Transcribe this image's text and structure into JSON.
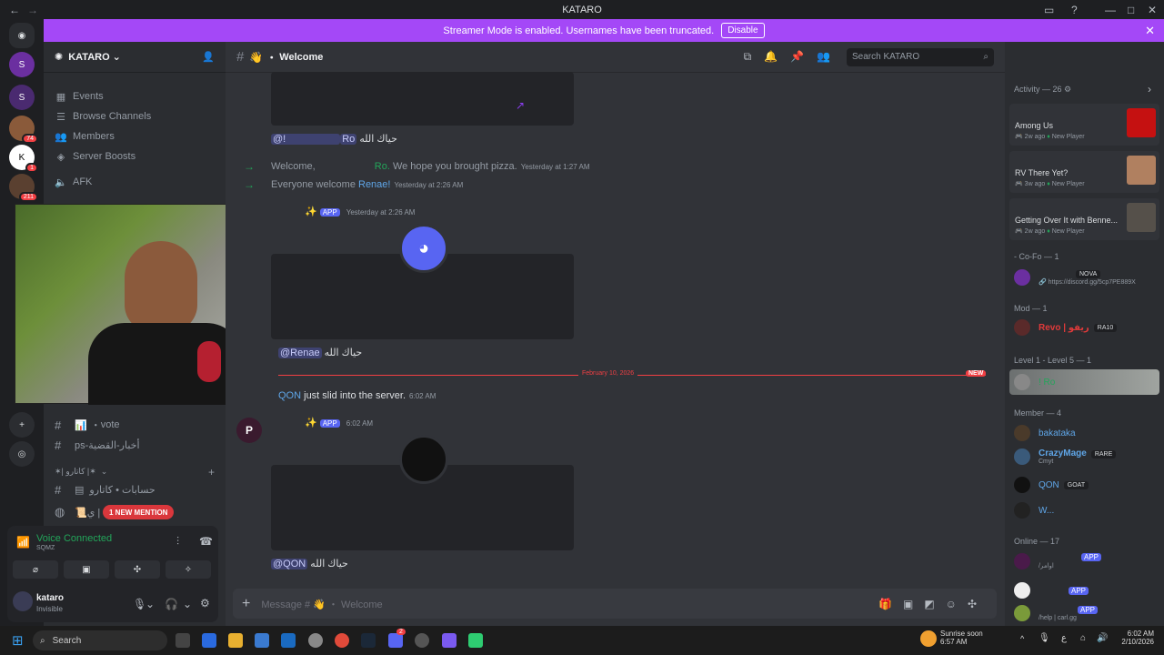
{
  "window": {
    "title": "KATARO"
  },
  "banner": {
    "text": "Streamer Mode is enabled. Usernames have been truncated.",
    "disable_label": "Disable"
  },
  "rail": {
    "badges": [
      "74",
      "1",
      "211"
    ]
  },
  "sidebar": {
    "server_name": "KATARO",
    "nav": [
      {
        "label": "Events",
        "icon": "calendar-icon"
      },
      {
        "label": "Browse Channels",
        "icon": "browse-icon"
      },
      {
        "label": "Members",
        "icon": "members-icon"
      },
      {
        "label": "Server Boosts",
        "icon": "boost-icon"
      }
    ],
    "afk_label": "AFK",
    "channels": [
      {
        "name": "vote"
      },
      {
        "name": "ps-أخبار-القضية"
      }
    ],
    "category": "✶| كاتارو |✶",
    "channel_accounts": "حسابات • كاتارو",
    "mention_pill": "1 NEW MENTION",
    "partial_channel": "ي |"
  },
  "voice": {
    "status": "Voice Connected",
    "sub": "SQMZ"
  },
  "user": {
    "name": "kataro",
    "status": "Invisible"
  },
  "header": {
    "channel": "Welcome",
    "search_placeholder": "Search KATARO"
  },
  "messages": {
    "m1_mention": "@!",
    "m1_name": "Ro",
    "m1_text": "حياك الله",
    "j1_pre": "Welcome,",
    "j1_name": "Ro.",
    "j1_text": "We hope you brought pizza.",
    "j1_time": "Yesterday at 1:27 AM",
    "j2_pre": "Everyone welcome",
    "j2_name": "Renae!",
    "j2_time": "Yesterday at 2:26 AM",
    "b1_time": "Yesterday at 2:26 AM",
    "b1_mention": "@Renae",
    "b1_text": "حياك الله",
    "date_divider": "February 10, 2026",
    "new_label": "NEW",
    "j3_name": "QON",
    "j3_text": "just slid into the server.",
    "j3_time": "6:02 AM",
    "b2_time": "6:02 AM",
    "b2_mention": "@QON",
    "b2_text": "حياك الله",
    "app_label": "APP"
  },
  "composer": {
    "placeholder": "Message # 👋 ・ Welcome"
  },
  "right": {
    "activity_header": "Activity — 26",
    "activities": [
      {
        "game": "Among Us",
        "ago": "2w ago",
        "tag": "New Player"
      },
      {
        "game": "RV There Yet?",
        "ago": "3w ago",
        "tag": "New Player"
      },
      {
        "game": "Getting Over It with Benne...",
        "ago": "2w ago",
        "tag": "New Player"
      }
    ],
    "cofo_header": "- Co-Fo — 1",
    "cofo_tag": "NOVA",
    "cofo_link": "https://discord.gg/5cp7PE889X",
    "mod_header": "Mod — 1",
    "mod_name": "Revo | ريفو",
    "mod_tag": "RA10",
    "level_header": "Level 1 - Level 5 — 1",
    "level_member": "! Ro",
    "member_header": "Member — 4",
    "members": [
      {
        "name": "bakataka"
      },
      {
        "name": "CrazyMage",
        "tag": "RARE",
        "sub": "Cmyt"
      },
      {
        "name": "QON",
        "tag": "GOAT"
      },
      {
        "name": "W..."
      }
    ],
    "online_header": "Online — 17",
    "online": [
      {
        "sub": "/اوامر",
        "tag": "APP"
      },
      {
        "sub": "",
        "tag": "APP"
      },
      {
        "sub": "/help | carl.gg",
        "tag": "APP"
      }
    ]
  },
  "taskbar": {
    "search": "Search",
    "weather_title": "Sunrise soon",
    "weather_time": "6:57 AM",
    "time": "6:02 AM",
    "date": "2/10/2026",
    "discord_badge": "2"
  }
}
